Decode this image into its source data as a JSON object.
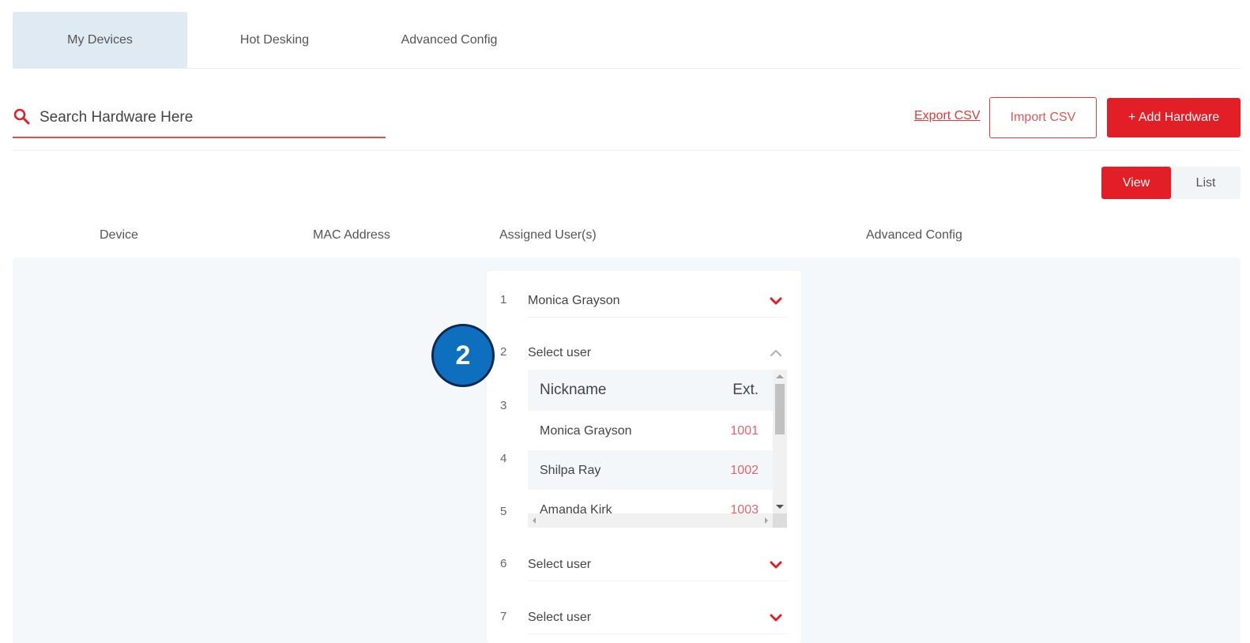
{
  "tabs": [
    {
      "label": "My Devices",
      "active": true
    },
    {
      "label": "Hot Desking",
      "active": false
    },
    {
      "label": "Advanced Config",
      "active": false
    }
  ],
  "search": {
    "placeholder": "Search Hardware Here",
    "icon": "search-icon"
  },
  "actions": {
    "export_label": "Export CSV",
    "import_label": "Import CSV",
    "add_label": "+ Add Hardware"
  },
  "view_toggle": {
    "view_label": "View",
    "list_label": "List",
    "selected": "View"
  },
  "columns": {
    "device": "Device",
    "mac": "MAC Address",
    "assigned": "Assigned User(s)",
    "advanced": "Advanced Config"
  },
  "user_slots": [
    {
      "number": "1",
      "label": "Monica Grayson",
      "expanded": false
    },
    {
      "number": "2",
      "label": "Select user",
      "expanded": true
    },
    {
      "number": "3"
    },
    {
      "number": "4"
    },
    {
      "number": "5"
    },
    {
      "number": "6",
      "label": "Select user",
      "expanded": false
    },
    {
      "number": "7",
      "label": "Select user",
      "expanded": false
    }
  ],
  "dropdown": {
    "header_nickname": "Nickname",
    "header_ext": "Ext.",
    "rows": [
      {
        "nickname": "Monica Grayson",
        "ext": "1001"
      },
      {
        "nickname": "Shilpa Ray",
        "ext": "1002"
      },
      {
        "nickname": "Amanda Kirk",
        "ext": "1003"
      }
    ]
  },
  "step_badge": "2",
  "colors": {
    "accent": "#e21f26",
    "tab_active_bg": "#dfeaf3",
    "badge_bg": "#0f6fbf",
    "ext_text": "#e4646a"
  }
}
